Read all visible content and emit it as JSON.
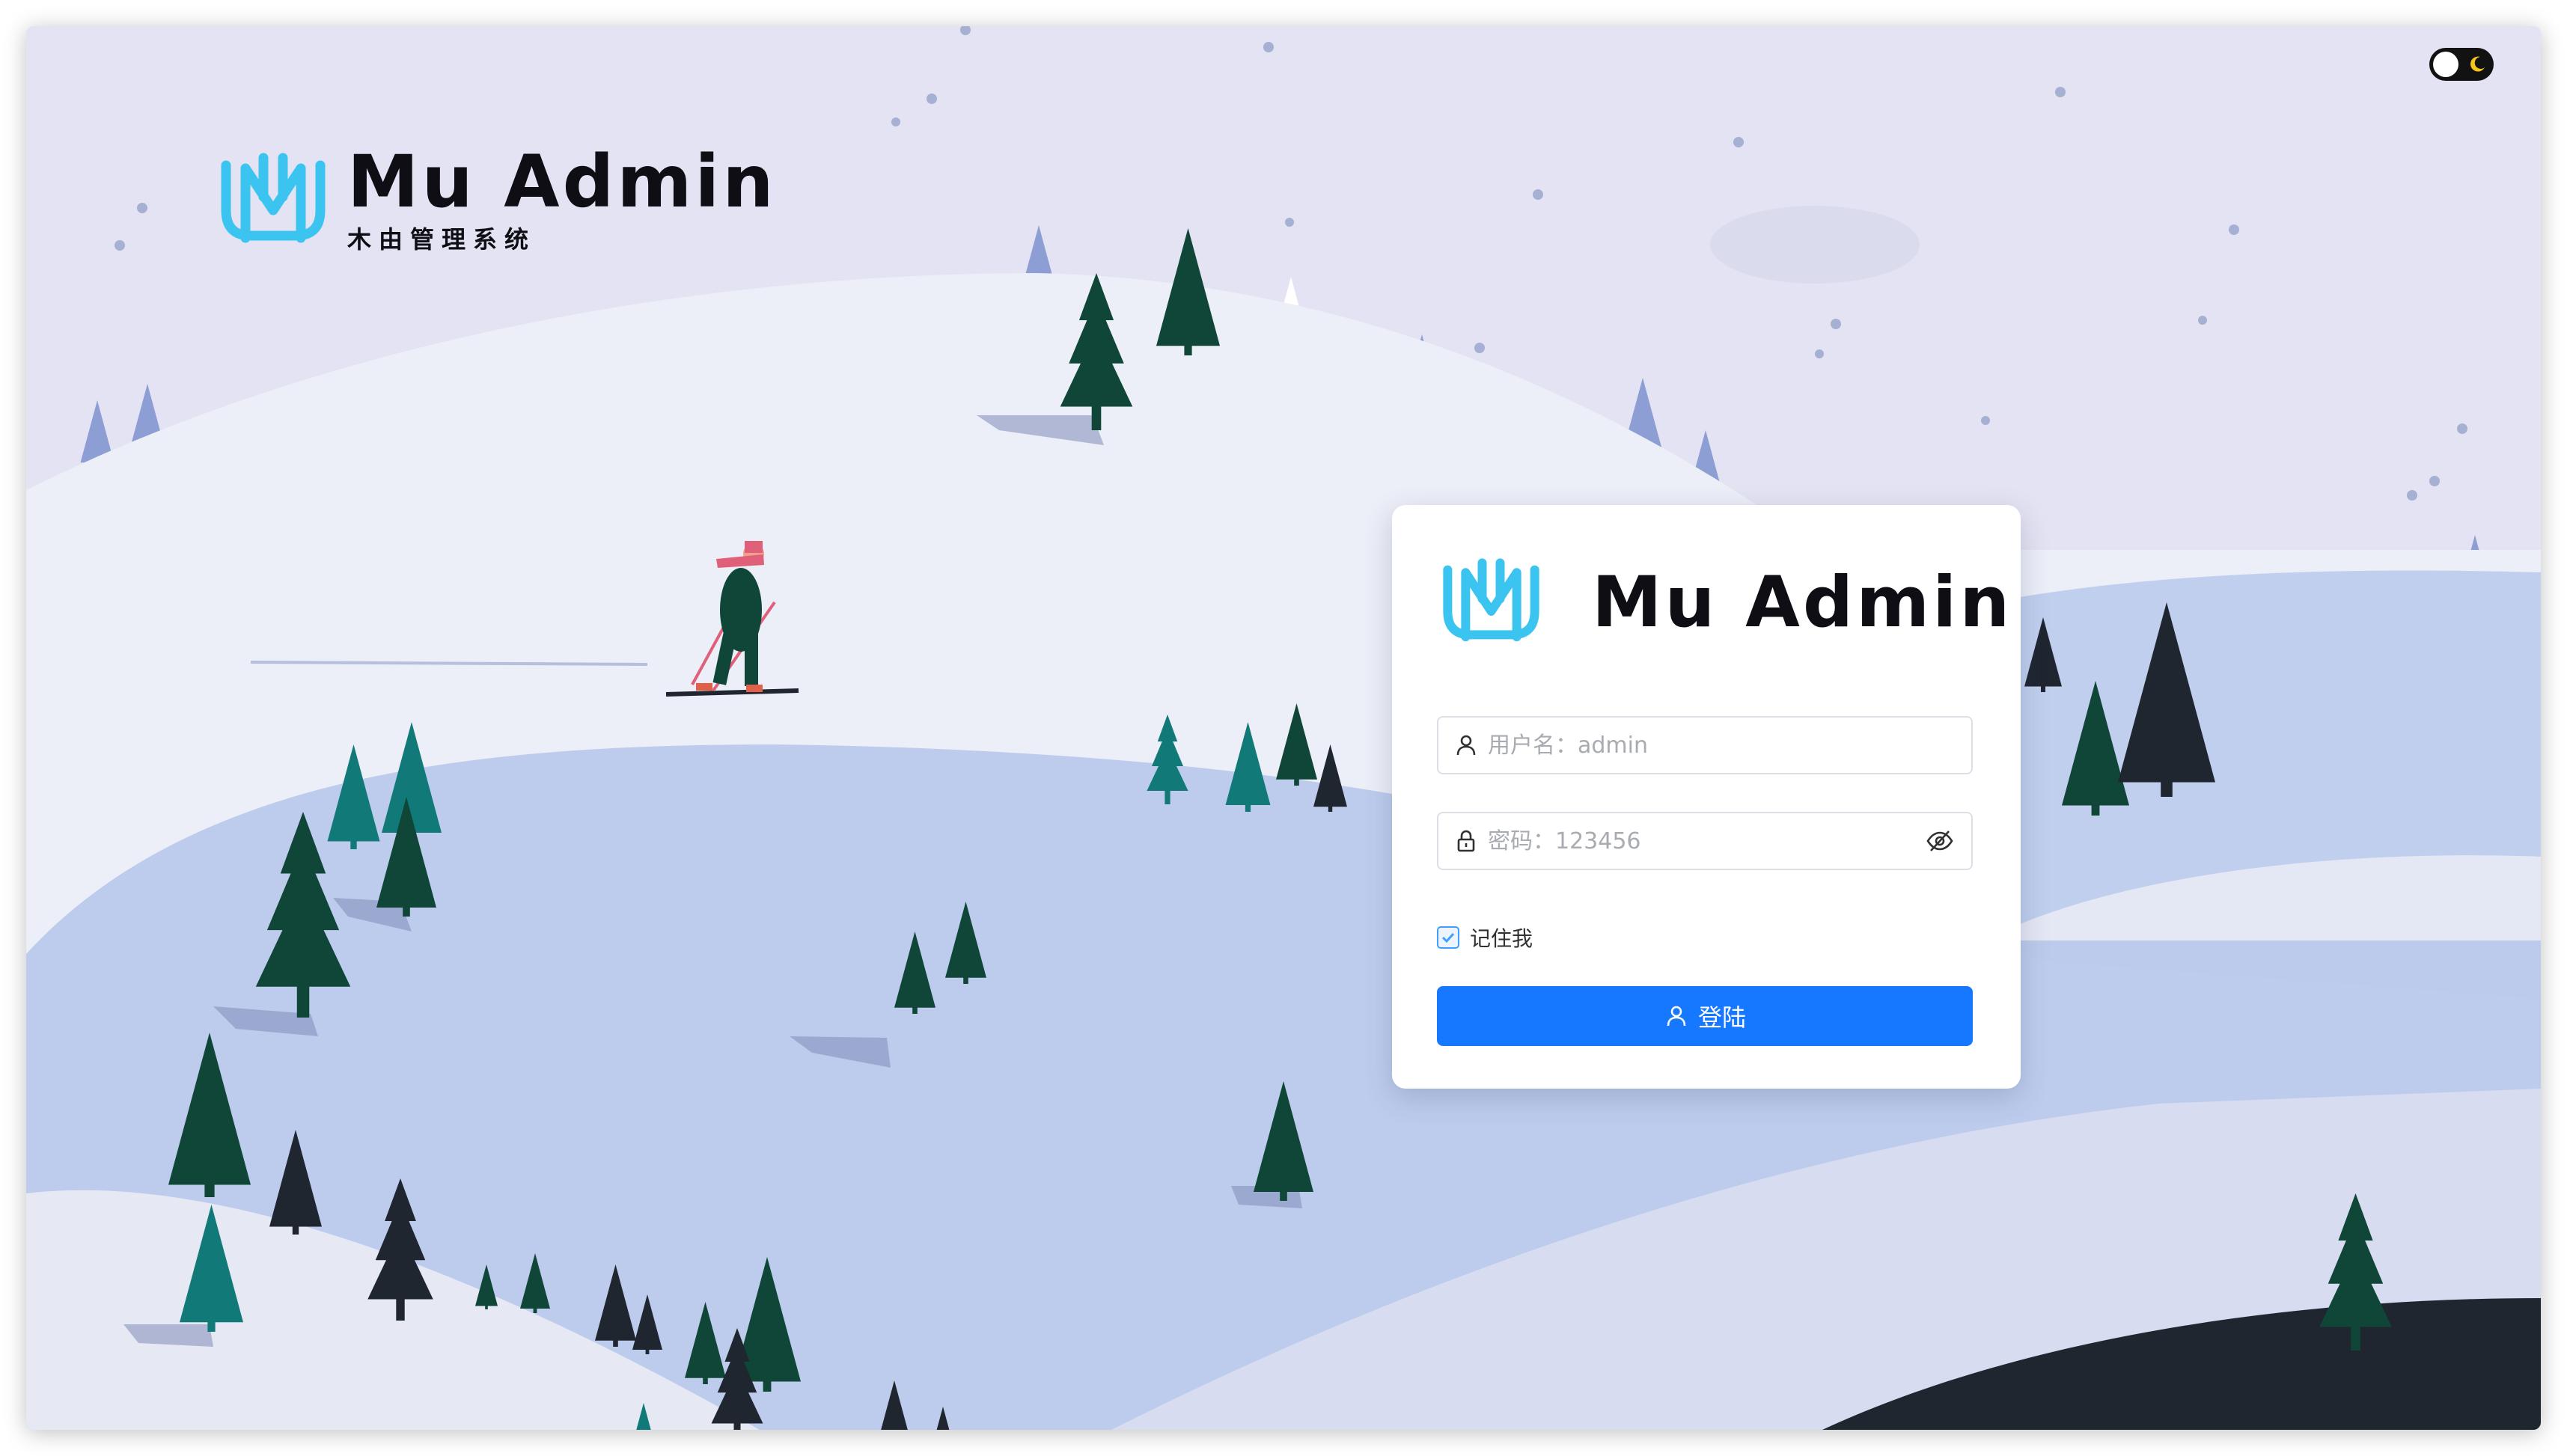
{
  "brand": {
    "title": "Mu Admin",
    "subtitle": "木由管理系统"
  },
  "theme_toggle": {
    "icon": "moon-icon",
    "state": "light"
  },
  "login": {
    "title": "Mu Admin",
    "username": {
      "placeholder": "用户名：admin",
      "value": "",
      "icon": "user-icon"
    },
    "password": {
      "placeholder": "密码：123456",
      "value": "",
      "icon": "lock-icon",
      "toggle_icon": "eye-hidden-icon"
    },
    "remember": {
      "label": "记住我",
      "checked": true
    },
    "submit": {
      "label": "登陆",
      "icon": "user-icon"
    }
  },
  "colors": {
    "background": "#e3e3f3",
    "brand_cyan": "#3cc4f0",
    "primary_button": "#1677ff",
    "tree_dark_green": "#0f4638",
    "tree_teal": "#117a78",
    "hill_light": "#eef0fa",
    "hill_blue": "#b9c9ea"
  }
}
